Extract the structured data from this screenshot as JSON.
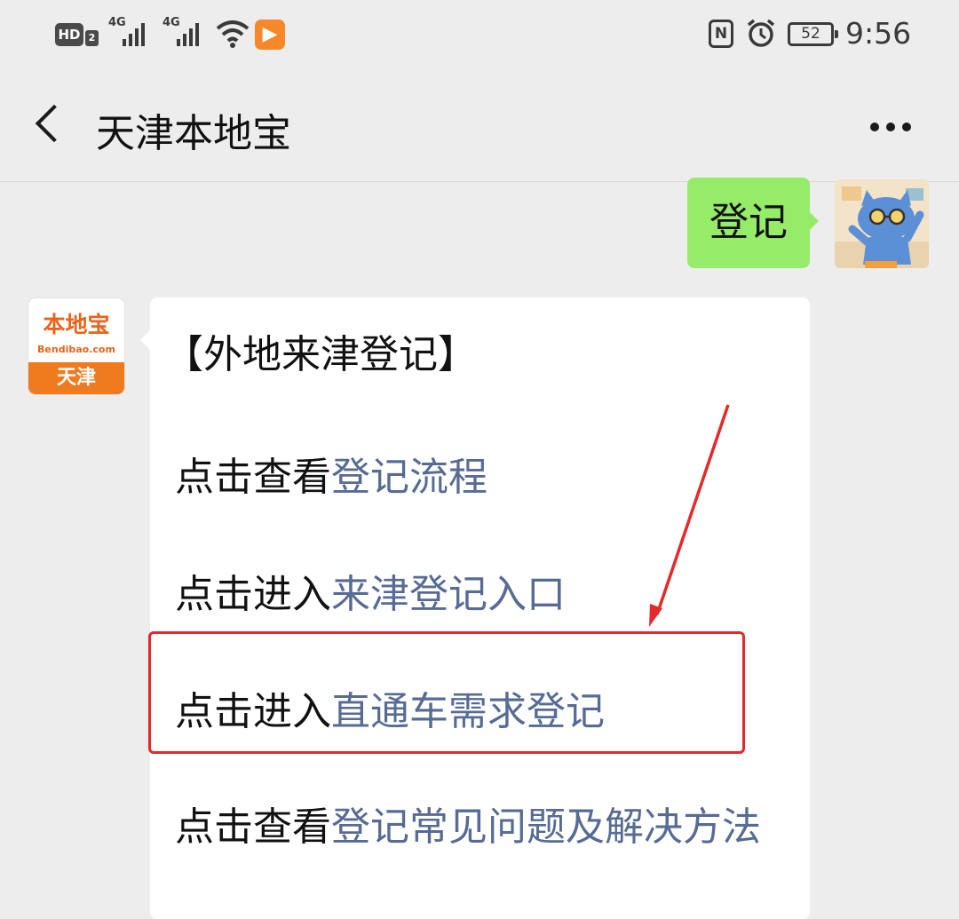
{
  "status_bar": {
    "hd_label": "HD",
    "hd_sub": "2",
    "network_1": "4G",
    "network_2": "4G",
    "battery": "52",
    "time": "9:56",
    "icons": [
      "wifi-icon",
      "video-app-icon",
      "nfc-icon",
      "alarm-icon",
      "battery-icon"
    ]
  },
  "header": {
    "title": "天津本地宝",
    "back_icon": "chevron-left-icon",
    "more_icon": "more-dots-icon"
  },
  "messages": {
    "outgoing": {
      "text": "登记"
    },
    "incoming": {
      "avatar": {
        "top": "本地宝",
        "url": "Bendibao.com",
        "bottom": "天津"
      },
      "heading": "【外地来津登记】",
      "lines": [
        {
          "prefix": "点击查看",
          "link": "登记流程"
        },
        {
          "prefix": "点击进入",
          "link": "来津登记入口"
        },
        {
          "prefix": "点击进入",
          "link": "直通车需求登记"
        },
        {
          "prefix": "点击查看",
          "link": "登记常见问题及解决方法"
        }
      ]
    }
  },
  "annotation": {
    "color": "#e5282a"
  },
  "colors": {
    "link": "#576b95",
    "bubble_out": "#95ec69",
    "background": "#ededed"
  }
}
